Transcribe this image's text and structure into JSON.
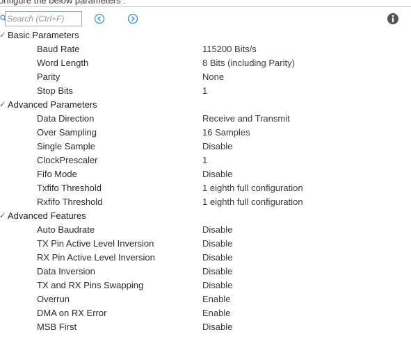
{
  "header": {
    "hint": "onfigure the below parameters :"
  },
  "toolbar": {
    "search_placeholder": "Search (Ctrl+F)",
    "prev_icon": "chevron-left-circle-icon",
    "next_icon": "chevron-right-circle-icon",
    "info_icon": "info-icon"
  },
  "colors": {
    "accent": "#3d8fd6",
    "info_icon": "#555555",
    "divider": "#d6d6d6"
  },
  "groups": [
    {
      "label": "Basic Parameters",
      "params": [
        {
          "name": "Baud Rate",
          "value": "115200 Bits/s"
        },
        {
          "name": "Word Length",
          "value": "8 Bits (including Parity)"
        },
        {
          "name": "Parity",
          "value": "None"
        },
        {
          "name": "Stop Bits",
          "value": "1"
        }
      ]
    },
    {
      "label": "Advanced Parameters",
      "params": [
        {
          "name": "Data Direction",
          "value": "Receive and Transmit"
        },
        {
          "name": "Over Sampling",
          "value": "16 Samples"
        },
        {
          "name": "Single Sample",
          "value": "Disable"
        },
        {
          "name": "ClockPrescaler",
          "value": "1"
        },
        {
          "name": "Fifo Mode",
          "value": "Disable"
        },
        {
          "name": "Txfifo Threshold",
          "value": "1 eighth full configuration"
        },
        {
          "name": "Rxfifo Threshold",
          "value": "1 eighth full configuration"
        }
      ]
    },
    {
      "label": "Advanced Features",
      "params": [
        {
          "name": "Auto Baudrate",
          "value": "Disable"
        },
        {
          "name": "TX Pin Active Level Inversion",
          "value": "Disable"
        },
        {
          "name": "RX Pin Active Level Inversion",
          "value": "Disable"
        },
        {
          "name": "Data Inversion",
          "value": "Disable"
        },
        {
          "name": "TX and RX Pins Swapping",
          "value": "Disable"
        },
        {
          "name": "Overrun",
          "value": "Enable"
        },
        {
          "name": "DMA on RX Error",
          "value": "Enable"
        },
        {
          "name": "MSB First",
          "value": "Disable"
        }
      ]
    }
  ]
}
